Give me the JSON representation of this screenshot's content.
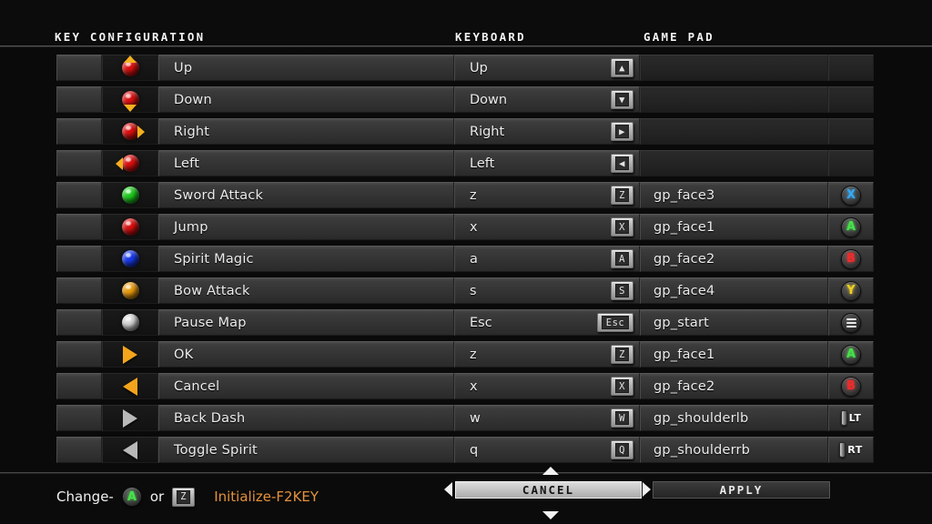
{
  "header": {
    "title": "KEY CONFIGURATION",
    "keyboard_column": "KEYBOARD",
    "gamepad_column": "GAME PAD"
  },
  "rows": [
    {
      "action": "Up",
      "icon": "red-sphere-up-arrow-icon",
      "sphere": "#e01010",
      "dir": "up",
      "key": "Up",
      "keycap": "▲",
      "keycap_icon": "arrow-up-key-icon",
      "gamepad": "",
      "gp_icon": ""
    },
    {
      "action": "Down",
      "icon": "red-sphere-down-arrow-icon",
      "sphere": "#e01010",
      "dir": "down",
      "key": "Down",
      "keycap": "▼",
      "keycap_icon": "arrow-down-key-icon",
      "gamepad": "",
      "gp_icon": ""
    },
    {
      "action": "Right",
      "icon": "red-sphere-right-arrow-icon",
      "sphere": "#e01010",
      "dir": "right",
      "key": "Right",
      "keycap": "▶",
      "keycap_icon": "arrow-right-key-icon",
      "gamepad": "",
      "gp_icon": ""
    },
    {
      "action": "Left",
      "icon": "red-sphere-left-arrow-icon",
      "sphere": "#e01010",
      "dir": "left",
      "key": "Left",
      "keycap": "◀",
      "keycap_icon": "arrow-left-key-icon",
      "gamepad": "",
      "gp_icon": ""
    },
    {
      "action": "Sword Attack",
      "icon": "green-sphere-icon",
      "sphere": "#1fd11f",
      "dir": "",
      "key": "z",
      "keycap": "Z",
      "keycap_icon": "z-key-icon",
      "gamepad": "gp_face3",
      "gp_icon": "xbox-x-button-icon",
      "gp_glyph": "X",
      "gp_class": "gp-x"
    },
    {
      "action": "Jump",
      "icon": "red-sphere-icon",
      "sphere": "#e01010",
      "dir": "",
      "key": "x",
      "keycap": "X",
      "keycap_icon": "x-key-icon",
      "gamepad": "gp_face1",
      "gp_icon": "xbox-a-button-icon",
      "gp_glyph": "A",
      "gp_class": "gp-a"
    },
    {
      "action": "Spirit Magic",
      "icon": "blue-sphere-icon",
      "sphere": "#1a3cf0",
      "dir": "",
      "key": "a",
      "keycap": "A",
      "keycap_icon": "a-key-icon",
      "gamepad": "gp_face2",
      "gp_icon": "xbox-b-button-icon",
      "gp_glyph": "B",
      "gp_class": "gp-b"
    },
    {
      "action": "Bow Attack",
      "icon": "orange-sphere-icon",
      "sphere": "#f0a010",
      "dir": "",
      "key": "s",
      "keycap": "S",
      "keycap_icon": "s-key-icon",
      "gamepad": "gp_face4",
      "gp_icon": "xbox-y-button-icon",
      "gp_glyph": "Y",
      "gp_class": "gp-y"
    },
    {
      "action": "Pause Map",
      "icon": "white-sphere-icon",
      "sphere": "#dcdcdc",
      "dir": "",
      "key": "Esc",
      "keycap": "Esc",
      "keycap_icon": "esc-key-icon",
      "gamepad": "gp_start",
      "gp_icon": "xbox-start-button-icon",
      "gp_glyph": "",
      "gp_class": "gp-start"
    },
    {
      "action": "OK",
      "icon": "orange-triangle-right-icon",
      "tri": "right",
      "tri_color": "tri-orange",
      "key": "z",
      "keycap": "Z",
      "keycap_icon": "z-key-icon",
      "gamepad": "gp_face1",
      "gp_icon": "xbox-a-button-icon",
      "gp_glyph": "A",
      "gp_class": "gp-a"
    },
    {
      "action": "Cancel",
      "icon": "orange-triangle-left-icon",
      "tri": "left",
      "tri_color": "tri-orange",
      "key": "x",
      "keycap": "X",
      "keycap_icon": "x-key-icon",
      "gamepad": "gp_face2",
      "gp_icon": "xbox-b-button-icon",
      "gp_glyph": "B",
      "gp_class": "gp-b"
    },
    {
      "action": "Back Dash",
      "icon": "gray-triangle-right-icon",
      "tri": "right",
      "tri_color": "tri-gray",
      "key": "w",
      "keycap": "W",
      "keycap_icon": "w-key-icon",
      "gamepad": "gp_shoulderlb",
      "gp_icon": "xbox-lt-trigger-icon",
      "gp_glyph": "LT",
      "gp_class": "gp-trigger"
    },
    {
      "action": "Toggle Spirit",
      "icon": "gray-triangle-left-icon",
      "tri": "left",
      "tri_color": "tri-gray",
      "key": "q",
      "keycap": "Q",
      "keycap_icon": "q-key-icon",
      "gamepad": "gp_shoulderrb",
      "gp_icon": "xbox-rt-trigger-icon",
      "gp_glyph": "RT",
      "gp_class": "gp-trigger"
    }
  ],
  "footer": {
    "change_label": "Change-",
    "or_label": "or",
    "change_button_glyph": "A",
    "change_key_glyph": "Z",
    "initialize_label": "Initialize-F2KEY",
    "cancel_button": "CANCEL",
    "apply_button": "APPLY",
    "selected_button": "CANCEL"
  },
  "colors": {
    "accent_orange": "#e4913a",
    "sphere_red": "#e01010",
    "sphere_green": "#1fd11f",
    "sphere_blue": "#1a3cf0",
    "sphere_orange": "#f0a010",
    "sphere_white": "#dcdcdc",
    "xbox_a": "#46e24a",
    "xbox_b": "#ef2b2b",
    "xbox_x": "#35a8f0",
    "xbox_y": "#f0d020",
    "arrow_yellow": "#f5b01e"
  }
}
